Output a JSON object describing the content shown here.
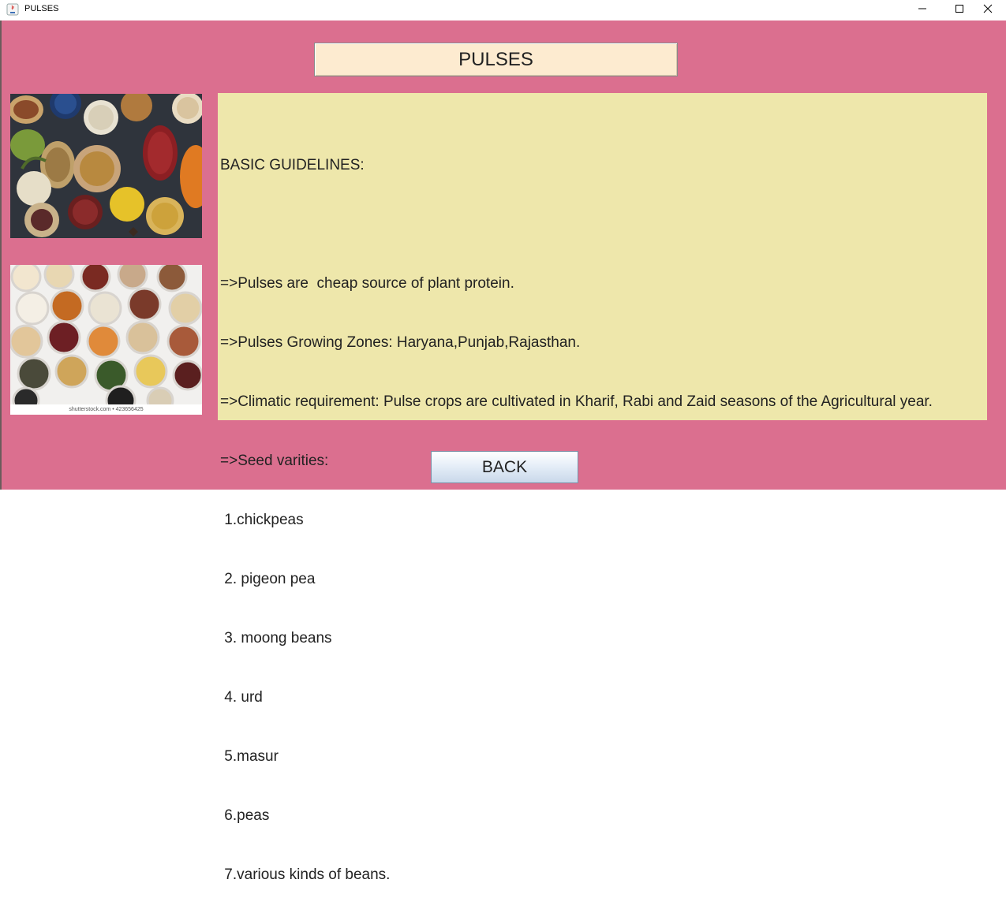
{
  "window": {
    "title": "PULSES",
    "controls": [
      "minimize-icon",
      "maximize-icon",
      "close-icon"
    ]
  },
  "header": {
    "title": "PULSES"
  },
  "images": [
    {
      "name": "pulses-spoons-image"
    },
    {
      "name": "pulses-bowls-image",
      "caption": "shutterstock.com • 423656425"
    }
  ],
  "guidelines": {
    "lines": [
      "BASIC GUIDELINES:",
      "",
      "=>Pulses are  cheap source of plant protein.",
      "=>Pulses Growing Zones: Haryana,Punjab,Rajasthan.",
      "=>Climatic requirement: Pulse crops are cultivated in Kharif, Rabi and Zaid seasons of the Agricultural year.",
      "=>Seed varities:",
      " 1.chickpeas",
      " 2. pigeon pea",
      " 3. moong beans",
      " 4. urd",
      " 5.masur",
      " 6.peas",
      " 7.various kinds of beans."
    ]
  },
  "back_button": {
    "label": "BACK"
  },
  "colors": {
    "background": "#db6f8f",
    "header_fill": "#fdebd0",
    "text_area_fill": "#eee7ab"
  }
}
